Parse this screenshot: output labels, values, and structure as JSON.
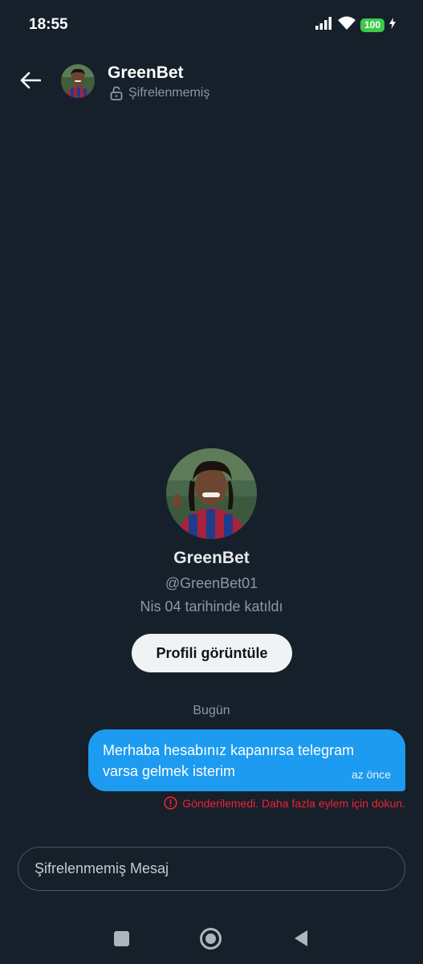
{
  "status_bar": {
    "time": "18:55",
    "battery": "100",
    "icons": [
      "signal-icon",
      "wifi-icon",
      "battery-icon",
      "charging-icon"
    ]
  },
  "header": {
    "name": "GreenBet",
    "encryption_status": "Şifrelenmemiş",
    "icons": [
      "back-arrow-icon",
      "unlocked-icon"
    ]
  },
  "profile": {
    "name": "GreenBet",
    "handle": "@GreenBet01",
    "joined": "Nis 04 tarihinde katıldı",
    "view_profile_label": "Profili görüntüle"
  },
  "conversation": {
    "day_label": "Bugün",
    "messages": [
      {
        "text": "Merhaba hesabınız kapanırsa telegram varsa gelmek isterim",
        "time": "az önce",
        "error": "Gönderilemedi. Daha fazla eylem için dokun."
      }
    ]
  },
  "compose": {
    "placeholder": "Şifrelenmemiş Mesaj",
    "value": ""
  },
  "colors": {
    "background": "#15202b",
    "accent": "#1d9bf0",
    "error": "#f4212e",
    "muted": "#8b98a5"
  }
}
